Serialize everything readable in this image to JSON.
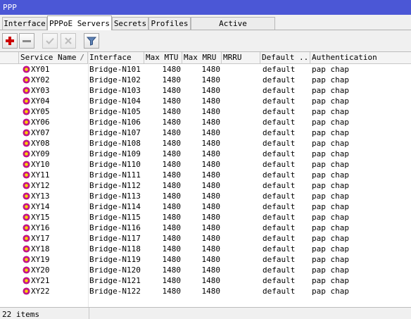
{
  "window": {
    "title": "PPP"
  },
  "tabs": [
    {
      "label": "Interface"
    },
    {
      "label": "PPPoE Servers"
    },
    {
      "label": "Secrets"
    },
    {
      "label": "Profiles"
    },
    {
      "label": "Active Connections"
    }
  ],
  "active_tab": "PPPoE Servers",
  "toolbar": {
    "buttons": [
      {
        "name": "add",
        "icon": "plus-icon",
        "color": "#cc0000"
      },
      {
        "name": "remove",
        "icon": "minus-icon"
      },
      {
        "name": "enable",
        "icon": "check-icon"
      },
      {
        "name": "disable",
        "icon": "cross-icon"
      },
      {
        "name": "filter",
        "icon": "filter-icon"
      }
    ]
  },
  "table": {
    "columns": [
      "Service Name",
      "Interface",
      "Max MTU",
      "Max MRU",
      "MRRU",
      "Default ...",
      "Authentication"
    ],
    "sort_indicator": "/",
    "row_icon": "pppoe-server-icon",
    "rows": [
      {
        "service": "XY01",
        "interface": "Bridge-N101",
        "mtu": "1480",
        "mru": "1480",
        "mrru": "",
        "default": "default",
        "auth": "pap chap"
      },
      {
        "service": "XY02",
        "interface": "Bridge-N102",
        "mtu": "1480",
        "mru": "1480",
        "mrru": "",
        "default": "default",
        "auth": "pap chap"
      },
      {
        "service": "XY03",
        "interface": "Bridge-N103",
        "mtu": "1480",
        "mru": "1480",
        "mrru": "",
        "default": "default",
        "auth": "pap chap"
      },
      {
        "service": "XY04",
        "interface": "Bridge-N104",
        "mtu": "1480",
        "mru": "1480",
        "mrru": "",
        "default": "default",
        "auth": "pap chap"
      },
      {
        "service": "XY05",
        "interface": "Bridge-N105",
        "mtu": "1480",
        "mru": "1480",
        "mrru": "",
        "default": "default",
        "auth": "pap chap"
      },
      {
        "service": "XY06",
        "interface": "Bridge-N106",
        "mtu": "1480",
        "mru": "1480",
        "mrru": "",
        "default": "default",
        "auth": "pap chap"
      },
      {
        "service": "XY07",
        "interface": "Bridge-N107",
        "mtu": "1480",
        "mru": "1480",
        "mrru": "",
        "default": "default",
        "auth": "pap chap"
      },
      {
        "service": "XY08",
        "interface": "Bridge-N108",
        "mtu": "1480",
        "mru": "1480",
        "mrru": "",
        "default": "default",
        "auth": "pap chap"
      },
      {
        "service": "XY09",
        "interface": "Bridge-N109",
        "mtu": "1480",
        "mru": "1480",
        "mrru": "",
        "default": "default",
        "auth": "pap chap"
      },
      {
        "service": "XY10",
        "interface": "Bridge-N110",
        "mtu": "1480",
        "mru": "1480",
        "mrru": "",
        "default": "default",
        "auth": "pap chap"
      },
      {
        "service": "XY11",
        "interface": "Bridge-N111",
        "mtu": "1480",
        "mru": "1480",
        "mrru": "",
        "default": "default",
        "auth": "pap chap"
      },
      {
        "service": "XY12",
        "interface": "Bridge-N112",
        "mtu": "1480",
        "mru": "1480",
        "mrru": "",
        "default": "default",
        "auth": "pap chap"
      },
      {
        "service": "XY13",
        "interface": "Bridge-N113",
        "mtu": "1480",
        "mru": "1480",
        "mrru": "",
        "default": "default",
        "auth": "pap chap"
      },
      {
        "service": "XY14",
        "interface": "Bridge-N114",
        "mtu": "1480",
        "mru": "1480",
        "mrru": "",
        "default": "default",
        "auth": "pap chap"
      },
      {
        "service": "XY15",
        "interface": "Bridge-N115",
        "mtu": "1480",
        "mru": "1480",
        "mrru": "",
        "default": "default",
        "auth": "pap chap"
      },
      {
        "service": "XY16",
        "interface": "Bridge-N116",
        "mtu": "1480",
        "mru": "1480",
        "mrru": "",
        "default": "default",
        "auth": "pap chap"
      },
      {
        "service": "XY17",
        "interface": "Bridge-N117",
        "mtu": "1480",
        "mru": "1480",
        "mrru": "",
        "default": "default",
        "auth": "pap chap"
      },
      {
        "service": "XY18",
        "interface": "Bridge-N118",
        "mtu": "1480",
        "mru": "1480",
        "mrru": "",
        "default": "default",
        "auth": "pap chap"
      },
      {
        "service": "XY19",
        "interface": "Bridge-N119",
        "mtu": "1480",
        "mru": "1480",
        "mrru": "",
        "default": "default",
        "auth": "pap chap"
      },
      {
        "service": "XY20",
        "interface": "Bridge-N120",
        "mtu": "1480",
        "mru": "1480",
        "mrru": "",
        "default": "default",
        "auth": "pap chap"
      },
      {
        "service": "XY21",
        "interface": "Bridge-N121",
        "mtu": "1480",
        "mru": "1480",
        "mrru": "",
        "default": "default",
        "auth": "pap chap"
      },
      {
        "service": "XY22",
        "interface": "Bridge-N122",
        "mtu": "1480",
        "mru": "1480",
        "mrru": "",
        "default": "default",
        "auth": "pap chap"
      }
    ]
  },
  "status": {
    "items_count": "22 items"
  }
}
